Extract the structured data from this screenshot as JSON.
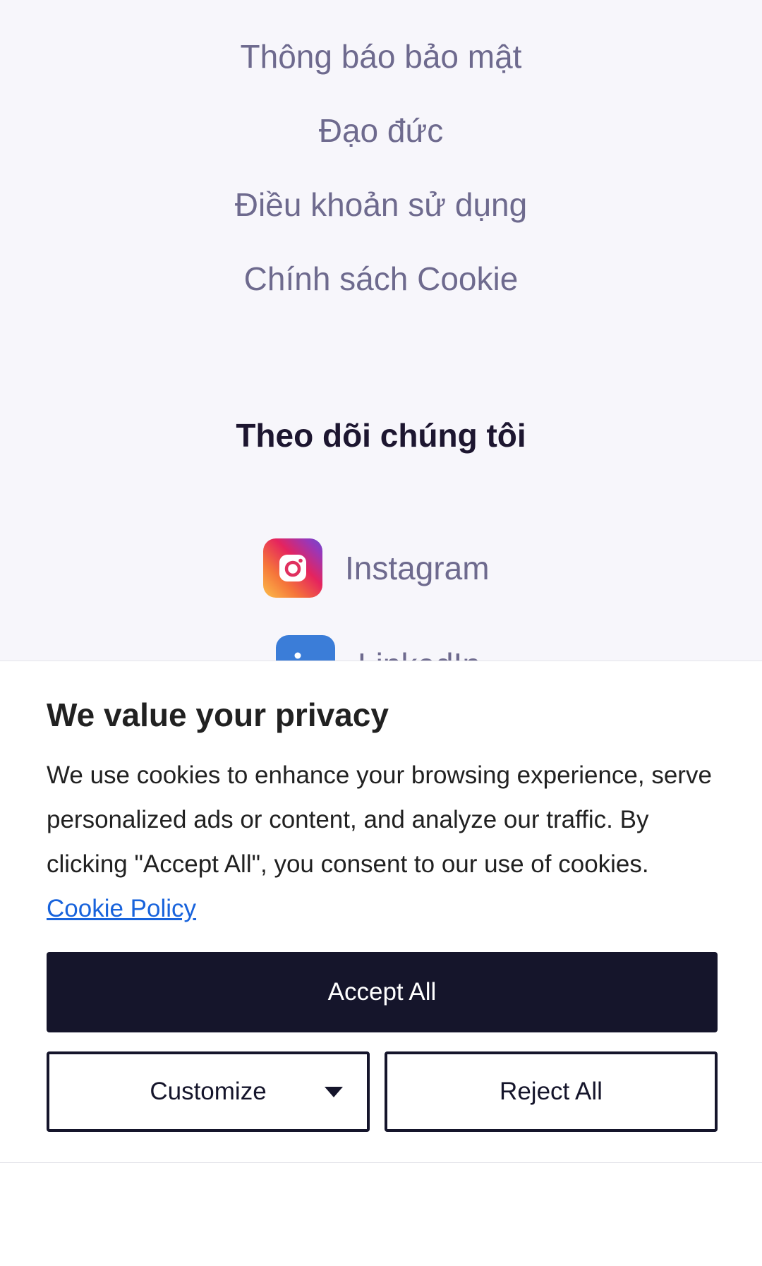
{
  "footer": {
    "links": [
      "Thông báo bảo mật",
      "Đạo đức",
      "Điều khoản sử dụng",
      "Chính sách Cookie"
    ],
    "follow_heading": "Theo dõi chúng tôi",
    "social": [
      {
        "label": "Instagram",
        "icon": "instagram-icon"
      },
      {
        "label": "LinkedIn",
        "icon": "linkedin-icon"
      }
    ]
  },
  "cookie_banner": {
    "title": "We value your privacy",
    "body": "We use cookies to enhance your browsing experience, serve personalized ads or content, and analyze our traffic. By clicking \"Accept All\", you consent to our use of cookies.",
    "policy_link": "Cookie Policy",
    "accept_label": "Accept All",
    "customize_label": "Customize",
    "reject_label": "Reject All"
  },
  "colors": {
    "footer_bg": "#f7f6fb",
    "footer_link": "#6e6a8e",
    "heading": "#1d1630",
    "button_dark": "#15152b",
    "link_blue": "#1863dc",
    "linkedin_blue": "#3b7dd8"
  }
}
